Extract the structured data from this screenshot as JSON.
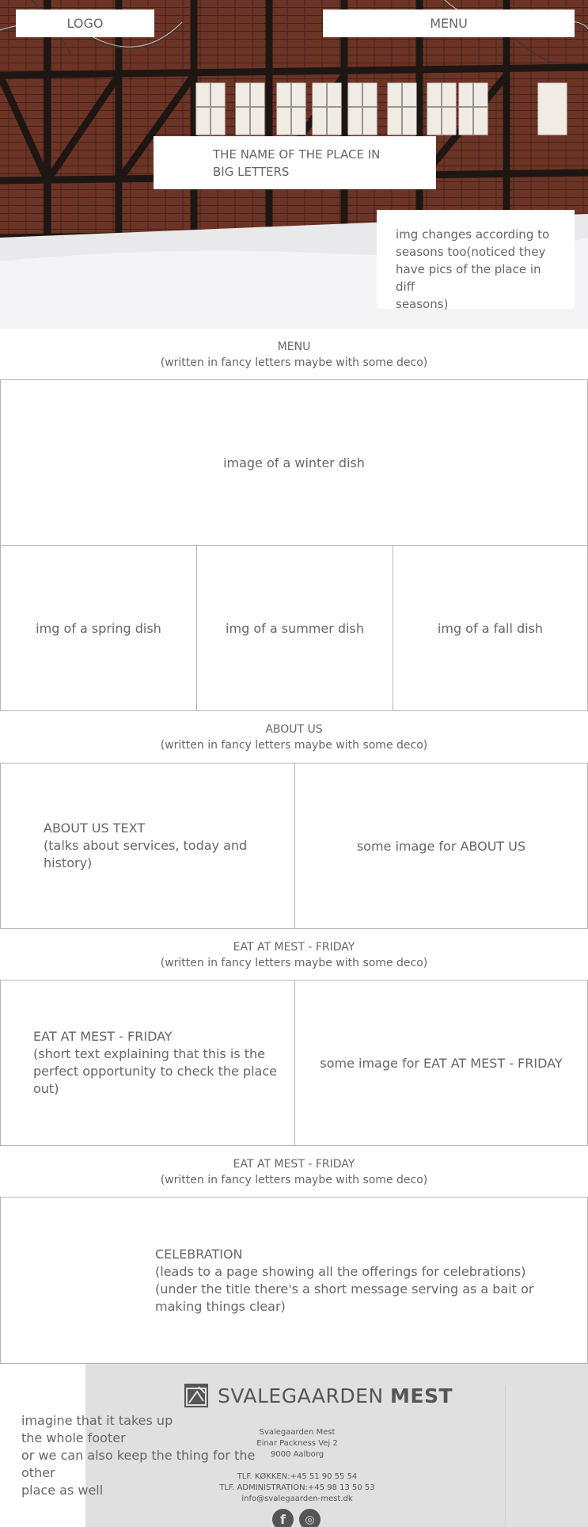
{
  "hero": {
    "logo": "LOGO",
    "menu": "MENU",
    "place_name_line1": "THE NAME OF THE PLACE IN",
    "place_name_line2": "BIG LETTERS",
    "season_note_line1": "img changes according to",
    "season_note_line2": "seasons too(noticed they",
    "season_note_line3": "have pics of the place in diff",
    "season_note_line4": "seasons)"
  },
  "menu_section": {
    "title": "MENU",
    "subtitle": "(written in fancy letters maybe with some deco)",
    "winter": "image of a winter dish",
    "spring": "img of a spring dish",
    "summer": "img of a summer dish",
    "fall": "img of a fall dish"
  },
  "about_section": {
    "title": "ABOUT US",
    "subtitle": "(written in fancy letters maybe with some deco)",
    "text_line1": "ABOUT US TEXT",
    "text_line2": "(talks about services, today and history)",
    "image": "some image for ABOUT US"
  },
  "eat_section": {
    "title": "EAT AT MEST - FRIDAY",
    "subtitle": "(written in fancy letters maybe with some deco)",
    "text_line1": "EAT AT MEST - FRIDAY",
    "text_line2": "(short text explaining that this is the",
    "text_line3": "perfect opportunity to check the place out)",
    "image": "some image for EAT AT MEST - FRIDAY"
  },
  "celebration_section": {
    "title": "EAT AT MEST - FRIDAY",
    "subtitle": "(written in fancy letters maybe with some deco)",
    "line1": "CELEBRATION",
    "line2": "(leads to a page showing all the offerings for celebrations)",
    "line3": "(under the title there's a short message serving as a bait or",
    "line4": "making things clear)"
  },
  "footer": {
    "brand_light": "SVALEGAARDEN",
    "brand_bold": "MEST",
    "company": "Svalegaarden Mest",
    "street": "Einar Packness Vej 2",
    "city": "9000 Aalborg",
    "phone_kitchen": "TLF. KØKKEN:+45 51 90 55 54",
    "phone_admin": "TLF. ADMINISTRATION:+45 98 13 50 53",
    "email": "info@svalegaarden-mest.dk",
    "facebook_glyph": "f",
    "instagram_glyph": "◎",
    "note_line1": "imagine that it takes up",
    "note_line2": "the whole footer",
    "note_line3": "or we can also keep the thing for the other",
    "note_line4": "place as well"
  }
}
